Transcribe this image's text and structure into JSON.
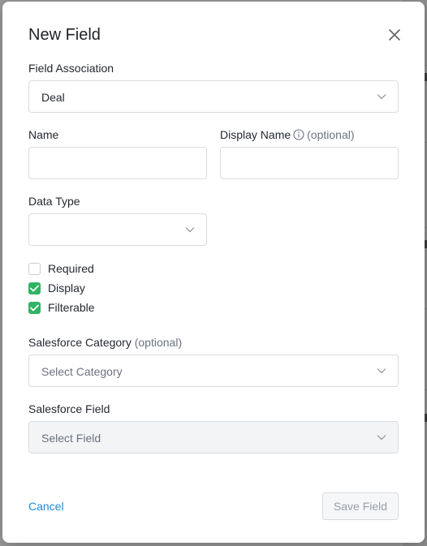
{
  "modal": {
    "title": "New Field",
    "field_association": {
      "label": "Field Association",
      "value": "Deal"
    },
    "name": {
      "label": "Name",
      "value": ""
    },
    "display_name": {
      "label": "Display Name",
      "optional": "(optional)",
      "value": ""
    },
    "data_type": {
      "label": "Data Type",
      "value": ""
    },
    "checkboxes": [
      {
        "label": "Required",
        "checked": false
      },
      {
        "label": "Display",
        "checked": true
      },
      {
        "label": "Filterable",
        "checked": true
      }
    ],
    "salesforce_category": {
      "label": "Salesforce Category",
      "optional": "(optional)",
      "placeholder": "Select Category"
    },
    "salesforce_field": {
      "label": "Salesforce Field",
      "placeholder": "Select Field",
      "disabled": true
    },
    "cancel_label": "Cancel",
    "save_label": "Save Field"
  },
  "colors": {
    "accent_link": "#1b8ad6",
    "checkbox_checked": "#2fb463",
    "border": "#d8dce0"
  },
  "icons": {
    "close": "close-icon",
    "chevron": "chevron-down-icon",
    "info": "info-icon",
    "check": "check-icon"
  }
}
